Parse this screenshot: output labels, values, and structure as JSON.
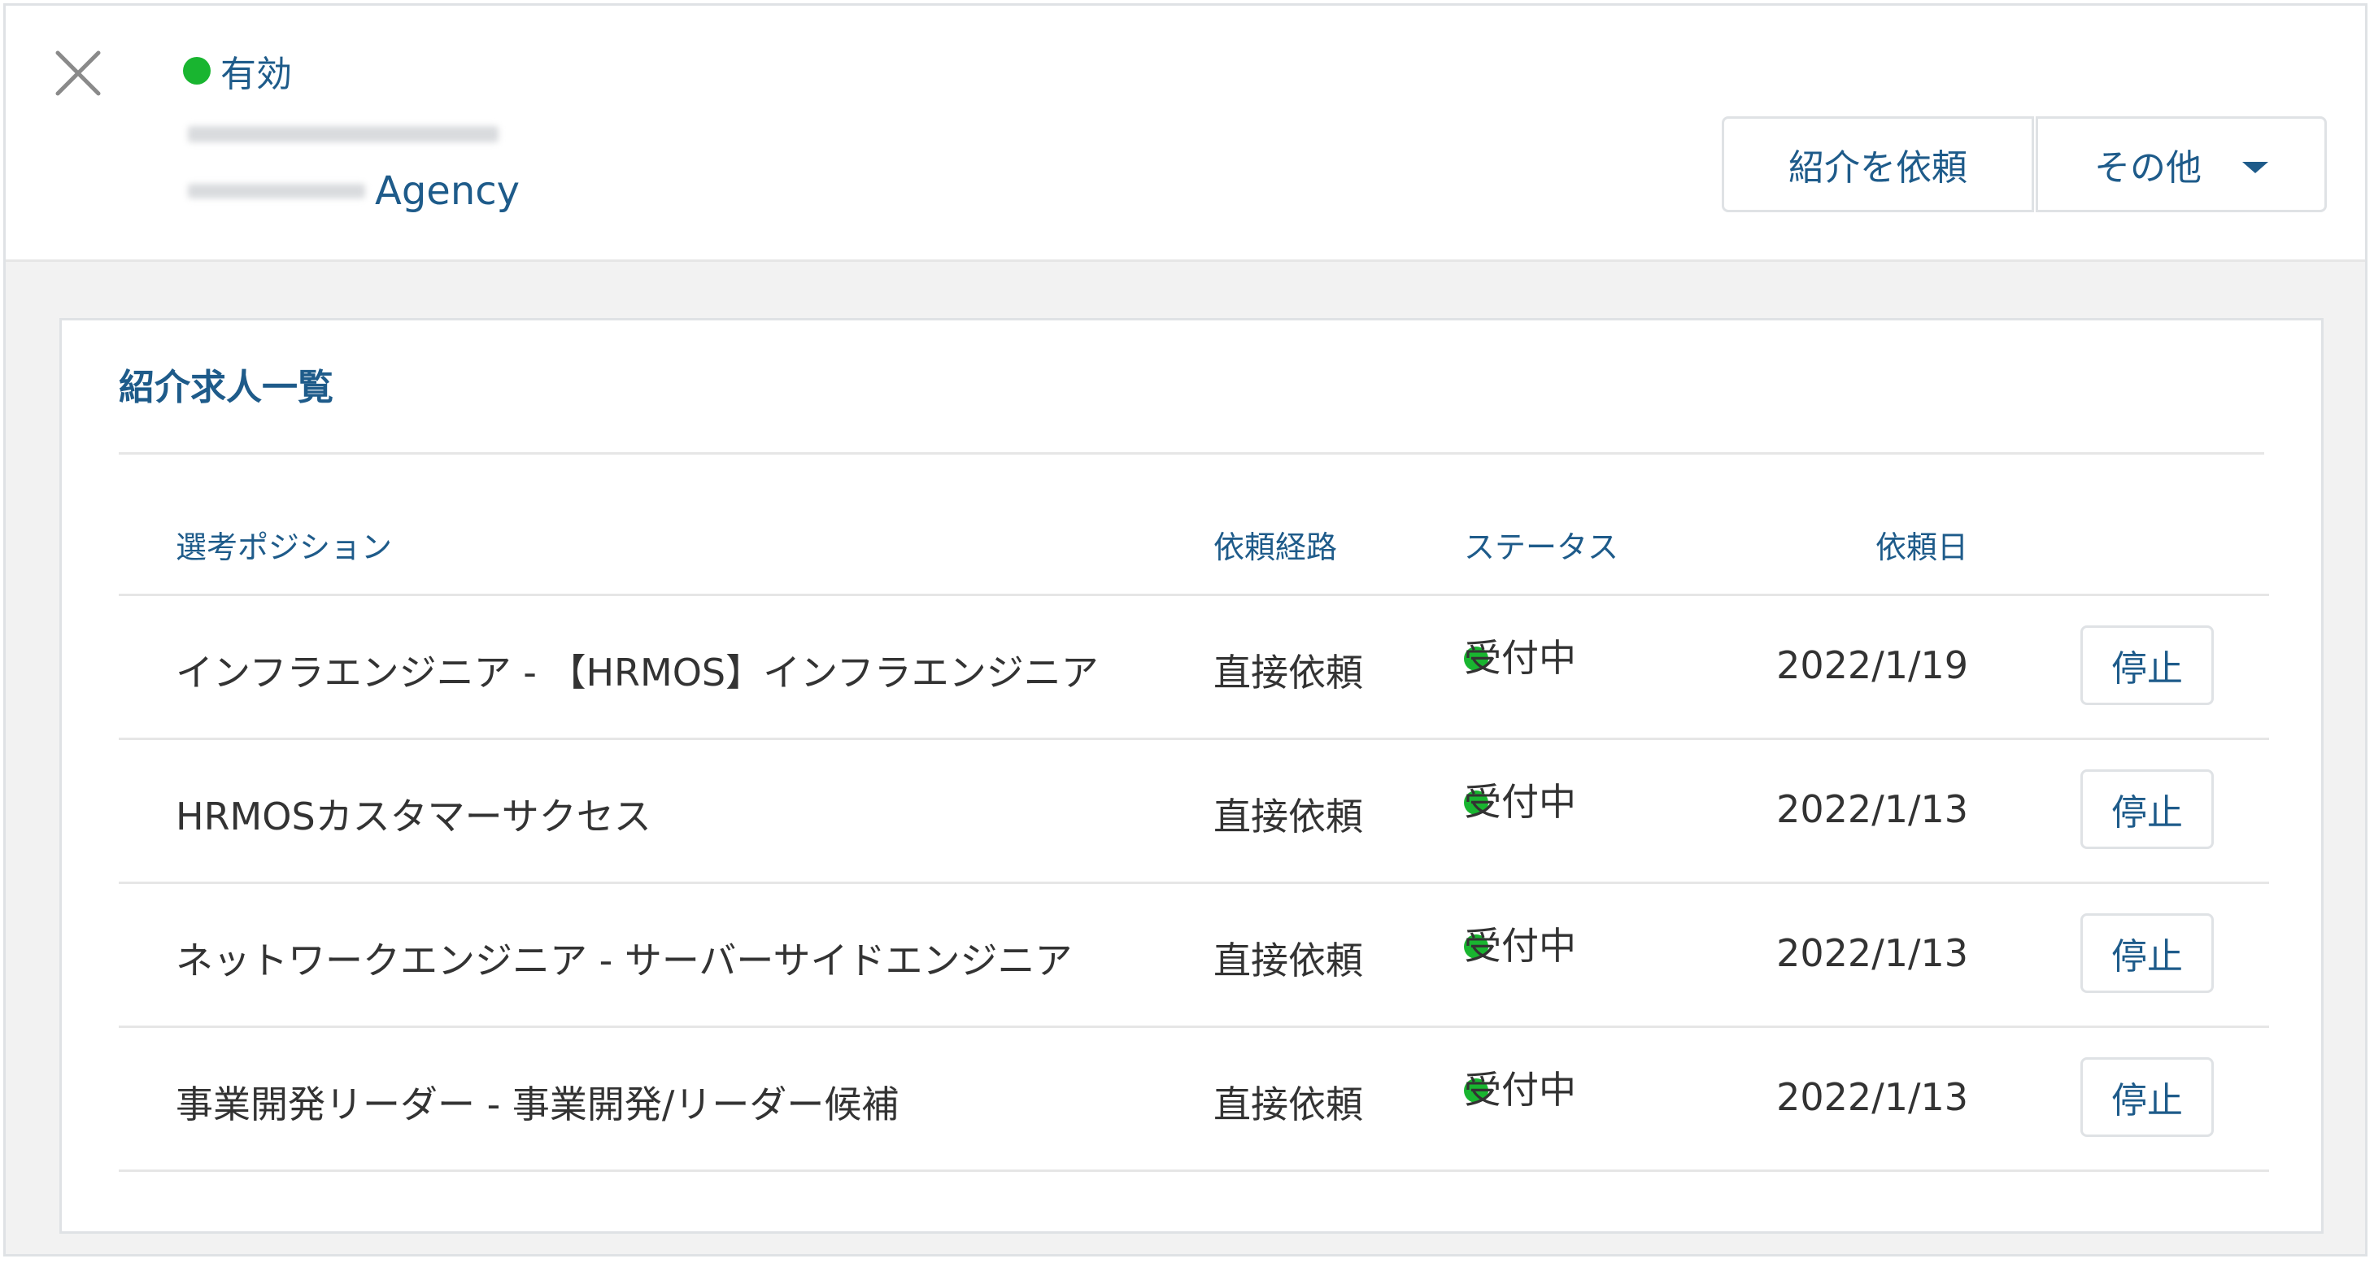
{
  "header": {
    "close_icon": "close-icon",
    "status_label": "有効",
    "status_color": "#19b530",
    "agency_suffix": "Agency",
    "request_button": "紹介を依頼",
    "other_button": "その他",
    "other_icon": "caret-down-icon"
  },
  "card": {
    "title": "紹介求人一覧",
    "columns": {
      "position": "選考ポジション",
      "route": "依頼経路",
      "status": "ステータス",
      "date": "依頼日"
    },
    "rows": [
      {
        "position": "インフラエンジニア - 【HRMOS】インフラエンジニア",
        "route": "直接依頼",
        "status": "受付中",
        "date": "2022/1/19",
        "action": "停止"
      },
      {
        "position": "HRMOSカスタマーサクセス",
        "route": "直接依頼",
        "status": "受付中",
        "date": "2022/1/13",
        "action": "停止"
      },
      {
        "position": "ネットワークエンジニア - サーバーサイドエンジニア",
        "route": "直接依頼",
        "status": "受付中",
        "date": "2022/1/13",
        "action": "停止"
      },
      {
        "position": "事業開発リーダー - 事業開発/リーダー候補",
        "route": "直接依頼",
        "status": "受付中",
        "date": "2022/1/13",
        "action": "停止"
      }
    ]
  },
  "colors": {
    "accent": "#1e5b8a",
    "status_active": "#19b530",
    "border": "#dfe2e5",
    "background": "#f2f2f2"
  }
}
